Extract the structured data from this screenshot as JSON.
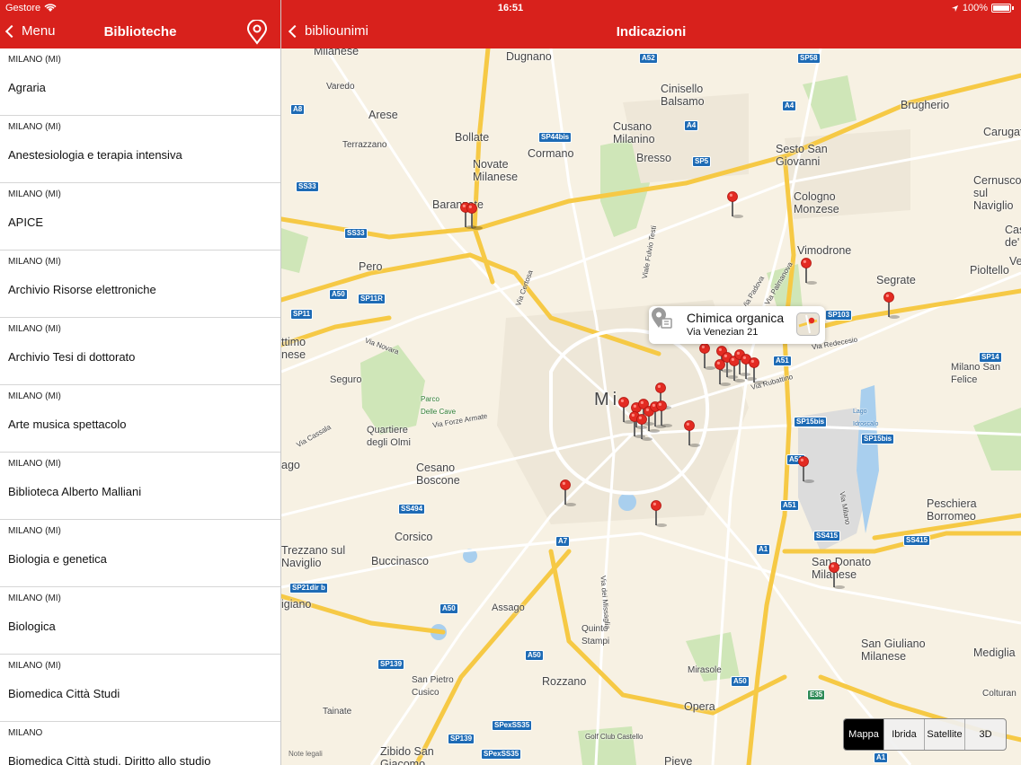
{
  "status": {
    "carrier": "Gestore",
    "time": "16:51",
    "battery": "100%"
  },
  "left_nav": {
    "back_label": "Menu",
    "title": "Biblioteche"
  },
  "right_nav": {
    "back_label": "bibliounimi",
    "title": "Indicazioni"
  },
  "libraries": [
    {
      "city": "MILANO (MI)",
      "name": "Agraria"
    },
    {
      "city": "MILANO (MI)",
      "name": "Anestesiologia e terapia intensiva"
    },
    {
      "city": "MILANO (MI)",
      "name": "APICE"
    },
    {
      "city": "MILANO (MI)",
      "name": "Archivio Risorse elettroniche"
    },
    {
      "city": "MILANO (MI)",
      "name": "Archivio Tesi di dottorato"
    },
    {
      "city": "MILANO (MI)",
      "name": "Arte musica spettacolo"
    },
    {
      "city": "MILANO (MI)",
      "name": "Biblioteca Alberto Malliani"
    },
    {
      "city": "MILANO (MI)",
      "name": "Biologia e genetica"
    },
    {
      "city": "MILANO (MI)",
      "name": "Biologica"
    },
    {
      "city": "MILANO (MI)",
      "name": "Biomedica Città Studi"
    },
    {
      "city": "MILANO",
      "name": "Biomedica Città studi. Diritto allo studio"
    }
  ],
  "map": {
    "callout": {
      "title": "Chimica organica",
      "address": "Via Venezian 21"
    },
    "map_types": [
      "Mappa",
      "Ibrida",
      "Satellite",
      "3D"
    ],
    "selected_map_type": "Mappa",
    "legal": "Note legali",
    "places": [
      "Milanese",
      "Dugnano",
      "Varedo",
      "Cinisello Balsamo",
      "Brugherio",
      "Arese",
      "Cusano Milanino",
      "Carugate",
      "Terrazzano",
      "Bollate",
      "Cormano",
      "Bresso",
      "Sesto San Giovanni",
      "Novate Milanese",
      "Cernusco sul Naviglio",
      "Baranzate",
      "Cologno Monzese",
      "Cas de'",
      "Vimodrone",
      "Pero",
      "Segrate",
      "Pioltello",
      "ttimo nese",
      "Seguro",
      "Milano San Felice",
      "Parco Delle Cave",
      "Mi",
      "Quartiere degli Olmi",
      "Cesano Boscone",
      "Peschiera Borromeo",
      "Corsico",
      "Buccinasco",
      "Trezzano sul Naviglio",
      "San Donato Milanese",
      "Assago",
      "Quinto Stampi",
      "San Giuliano Milanese",
      "Mediglia",
      "Rozzano",
      "Mirasole",
      "Opera",
      "Tainate",
      "San Pietro Cusico",
      "Zibido San Giacomo",
      "Pieve",
      "Colturan",
      "Via Novara",
      "Viale Fulvio Testi",
      "Via Palmanova",
      "Via Padova",
      "Via Certosa",
      "Via Forze Armate",
      "Via Rubattino",
      "Via Redecesio",
      "Via dei Missaglia",
      "Via Cassala",
      "Golf Club Castello",
      "Lago Idroscalo",
      "Via Milano",
      "ago",
      "igiano",
      "Ve"
    ],
    "roads": [
      "A52",
      "SP58",
      "A8",
      "A4",
      "SP44bis",
      "SP5",
      "SS33",
      "SS33",
      "A4",
      "A50",
      "SP11R",
      "SP11",
      "SP103",
      "A51",
      "SP14",
      "SP15bis",
      "SP15bis",
      "A51",
      "A51",
      "SS494",
      "A7",
      "SS415",
      "SS415",
      "A1",
      "SP21dir b",
      "A50",
      "SP139",
      "A50",
      "A50",
      "E35",
      "SPexSS35",
      "SP139",
      "SPexSS35",
      "A1"
    ]
  }
}
